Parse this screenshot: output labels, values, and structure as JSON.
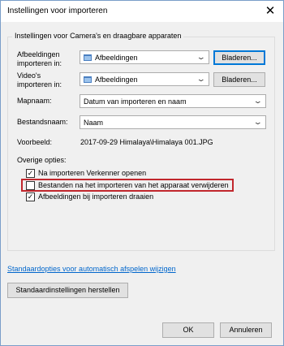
{
  "window": {
    "title": "Instellingen voor importeren"
  },
  "group": {
    "title_prefix": "Instellingen voor",
    "title_device": "Camera's en draagbare apparaten"
  },
  "images_folder": {
    "label_line1": "Afbeeldingen",
    "label_line2": "importeren in:",
    "value": "Afbeeldingen",
    "browse_label": "Bladeren..."
  },
  "videos_folder": {
    "label_line1": "Video's",
    "label_line2": "importeren in:",
    "value": "Afbeeldingen",
    "browse_label": "Bladeren..."
  },
  "folder_name": {
    "label": "Mapnaam:",
    "value": "Datum van importeren en naam"
  },
  "file_name": {
    "label": "Bestandsnaam:",
    "value": "Naam"
  },
  "example": {
    "label": "Voorbeeld:",
    "value": "2017-09-29 Himalaya\\Himalaya 001.JPG"
  },
  "other_options": {
    "label": "Overige opties:",
    "options": [
      {
        "label": "Na importeren Verkenner openen",
        "checked": true
      },
      {
        "label": "Bestanden na het importeren van het apparaat verwijderen",
        "checked": false
      },
      {
        "label": "Afbeeldingen bij importeren draaien",
        "checked": true
      }
    ]
  },
  "links": {
    "autoplay_defaults": "Standaardopties voor automatisch afspelen wijzigen"
  },
  "buttons": {
    "restore_defaults": "Standaardinstellingen herstellen",
    "ok": "OK",
    "cancel": "Annuleren"
  },
  "colors": {
    "highlight_border": "#c1272d",
    "link": "#0066cc",
    "accent": "#0078d7"
  }
}
